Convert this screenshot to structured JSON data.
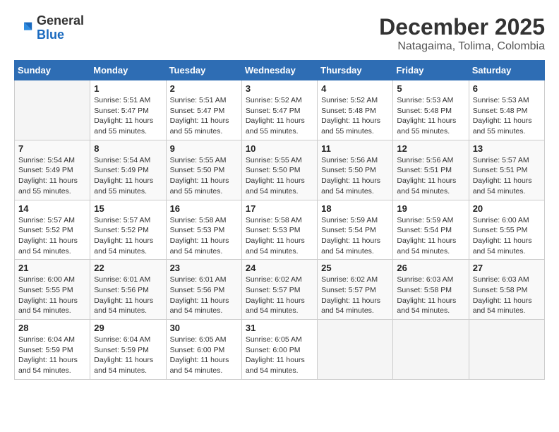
{
  "logo": {
    "general": "General",
    "blue": "Blue"
  },
  "title": "December 2025",
  "subtitle": "Natagaima, Tolima, Colombia",
  "days_header": [
    "Sunday",
    "Monday",
    "Tuesday",
    "Wednesday",
    "Thursday",
    "Friday",
    "Saturday"
  ],
  "weeks": [
    [
      {
        "num": "",
        "info": ""
      },
      {
        "num": "1",
        "info": "Sunrise: 5:51 AM\nSunset: 5:47 PM\nDaylight: 11 hours\nand 55 minutes."
      },
      {
        "num": "2",
        "info": "Sunrise: 5:51 AM\nSunset: 5:47 PM\nDaylight: 11 hours\nand 55 minutes."
      },
      {
        "num": "3",
        "info": "Sunrise: 5:52 AM\nSunset: 5:47 PM\nDaylight: 11 hours\nand 55 minutes."
      },
      {
        "num": "4",
        "info": "Sunrise: 5:52 AM\nSunset: 5:48 PM\nDaylight: 11 hours\nand 55 minutes."
      },
      {
        "num": "5",
        "info": "Sunrise: 5:53 AM\nSunset: 5:48 PM\nDaylight: 11 hours\nand 55 minutes."
      },
      {
        "num": "6",
        "info": "Sunrise: 5:53 AM\nSunset: 5:48 PM\nDaylight: 11 hours\nand 55 minutes."
      }
    ],
    [
      {
        "num": "7",
        "info": "Sunrise: 5:54 AM\nSunset: 5:49 PM\nDaylight: 11 hours\nand 55 minutes."
      },
      {
        "num": "8",
        "info": "Sunrise: 5:54 AM\nSunset: 5:49 PM\nDaylight: 11 hours\nand 55 minutes."
      },
      {
        "num": "9",
        "info": "Sunrise: 5:55 AM\nSunset: 5:50 PM\nDaylight: 11 hours\nand 55 minutes."
      },
      {
        "num": "10",
        "info": "Sunrise: 5:55 AM\nSunset: 5:50 PM\nDaylight: 11 hours\nand 54 minutes."
      },
      {
        "num": "11",
        "info": "Sunrise: 5:56 AM\nSunset: 5:50 PM\nDaylight: 11 hours\nand 54 minutes."
      },
      {
        "num": "12",
        "info": "Sunrise: 5:56 AM\nSunset: 5:51 PM\nDaylight: 11 hours\nand 54 minutes."
      },
      {
        "num": "13",
        "info": "Sunrise: 5:57 AM\nSunset: 5:51 PM\nDaylight: 11 hours\nand 54 minutes."
      }
    ],
    [
      {
        "num": "14",
        "info": "Sunrise: 5:57 AM\nSunset: 5:52 PM\nDaylight: 11 hours\nand 54 minutes."
      },
      {
        "num": "15",
        "info": "Sunrise: 5:57 AM\nSunset: 5:52 PM\nDaylight: 11 hours\nand 54 minutes."
      },
      {
        "num": "16",
        "info": "Sunrise: 5:58 AM\nSunset: 5:53 PM\nDaylight: 11 hours\nand 54 minutes."
      },
      {
        "num": "17",
        "info": "Sunrise: 5:58 AM\nSunset: 5:53 PM\nDaylight: 11 hours\nand 54 minutes."
      },
      {
        "num": "18",
        "info": "Sunrise: 5:59 AM\nSunset: 5:54 PM\nDaylight: 11 hours\nand 54 minutes."
      },
      {
        "num": "19",
        "info": "Sunrise: 5:59 AM\nSunset: 5:54 PM\nDaylight: 11 hours\nand 54 minutes."
      },
      {
        "num": "20",
        "info": "Sunrise: 6:00 AM\nSunset: 5:55 PM\nDaylight: 11 hours\nand 54 minutes."
      }
    ],
    [
      {
        "num": "21",
        "info": "Sunrise: 6:00 AM\nSunset: 5:55 PM\nDaylight: 11 hours\nand 54 minutes."
      },
      {
        "num": "22",
        "info": "Sunrise: 6:01 AM\nSunset: 5:56 PM\nDaylight: 11 hours\nand 54 minutes."
      },
      {
        "num": "23",
        "info": "Sunrise: 6:01 AM\nSunset: 5:56 PM\nDaylight: 11 hours\nand 54 minutes."
      },
      {
        "num": "24",
        "info": "Sunrise: 6:02 AM\nSunset: 5:57 PM\nDaylight: 11 hours\nand 54 minutes."
      },
      {
        "num": "25",
        "info": "Sunrise: 6:02 AM\nSunset: 5:57 PM\nDaylight: 11 hours\nand 54 minutes."
      },
      {
        "num": "26",
        "info": "Sunrise: 6:03 AM\nSunset: 5:58 PM\nDaylight: 11 hours\nand 54 minutes."
      },
      {
        "num": "27",
        "info": "Sunrise: 6:03 AM\nSunset: 5:58 PM\nDaylight: 11 hours\nand 54 minutes."
      }
    ],
    [
      {
        "num": "28",
        "info": "Sunrise: 6:04 AM\nSunset: 5:59 PM\nDaylight: 11 hours\nand 54 minutes."
      },
      {
        "num": "29",
        "info": "Sunrise: 6:04 AM\nSunset: 5:59 PM\nDaylight: 11 hours\nand 54 minutes."
      },
      {
        "num": "30",
        "info": "Sunrise: 6:05 AM\nSunset: 6:00 PM\nDaylight: 11 hours\nand 54 minutes."
      },
      {
        "num": "31",
        "info": "Sunrise: 6:05 AM\nSunset: 6:00 PM\nDaylight: 11 hours\nand 54 minutes."
      },
      {
        "num": "",
        "info": ""
      },
      {
        "num": "",
        "info": ""
      },
      {
        "num": "",
        "info": ""
      }
    ]
  ]
}
